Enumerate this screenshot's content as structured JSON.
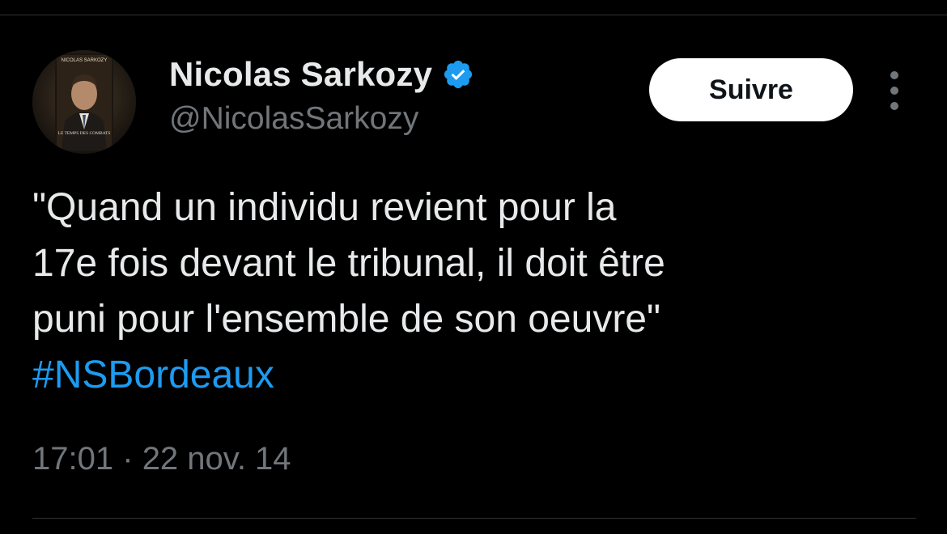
{
  "author": {
    "display_name": "Nicolas Sarkozy",
    "handle": "@NicolasSarkozy",
    "verified": true,
    "avatar_text_top": "NICOLAS SARKOZY",
    "avatar_text_bottom": "LE TEMPS DES COMBATS"
  },
  "actions": {
    "follow_label": "Suivre",
    "more_icon": "more-vertical-icon"
  },
  "tweet": {
    "lines": [
      "\"Quand un individu revient pour la",
      "17e fois devant le tribunal, il doit être",
      "puni pour l'ensemble de son oeuvre\""
    ],
    "hashtag": "#NSBordeaux"
  },
  "meta": {
    "time": "17:01",
    "separator": "·",
    "date": "22 nov. 14"
  },
  "colors": {
    "background": "#000000",
    "text_primary": "#e7e9ea",
    "text_secondary": "#71767b",
    "link": "#1d9bf0",
    "verified": "#1d9bf0",
    "divider": "#2f3336",
    "button_bg": "#ffffff",
    "button_text": "#0f1419"
  }
}
